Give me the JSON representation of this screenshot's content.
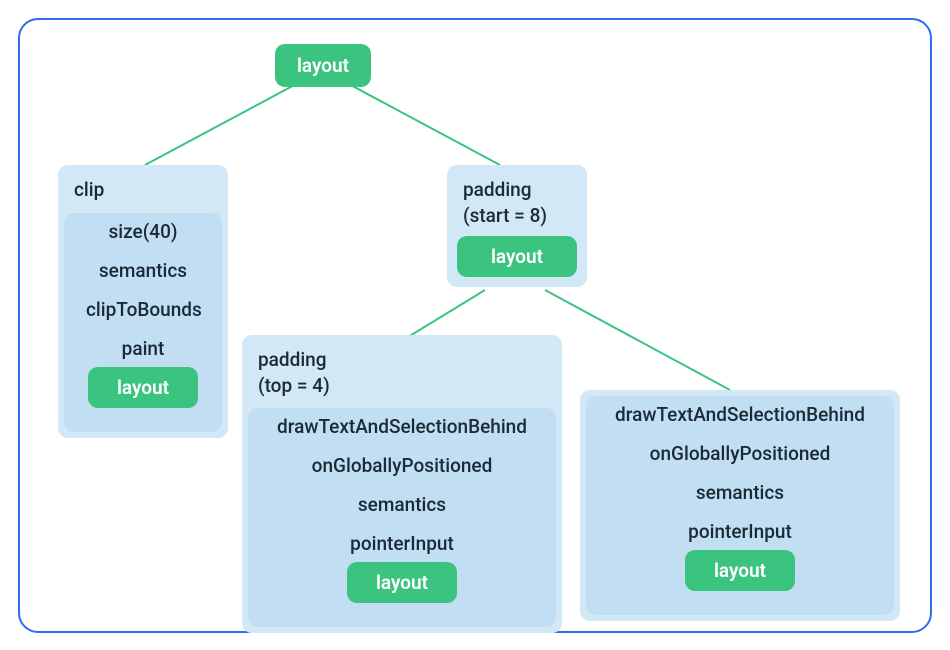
{
  "root": {
    "label": "layout"
  },
  "left_node": {
    "title": "clip",
    "layers": [
      "size(40)",
      "semantics",
      "clipToBounds",
      "paint"
    ],
    "leaf": "layout"
  },
  "right_node": {
    "title_line1": "padding",
    "title_line2": "(start = 8)",
    "leaf": "layout"
  },
  "bottom_left": {
    "title_line1": "padding",
    "title_line2": "(top = 4)",
    "layers": [
      "drawTextAndSelectionBehind",
      "onGloballyPositioned",
      "semantics",
      "pointerInput"
    ],
    "leaf": "layout"
  },
  "bottom_right": {
    "layers": [
      "drawTextAndSelectionBehind",
      "onGloballyPositioned",
      "semantics",
      "pointerInput"
    ],
    "leaf": "layout"
  }
}
